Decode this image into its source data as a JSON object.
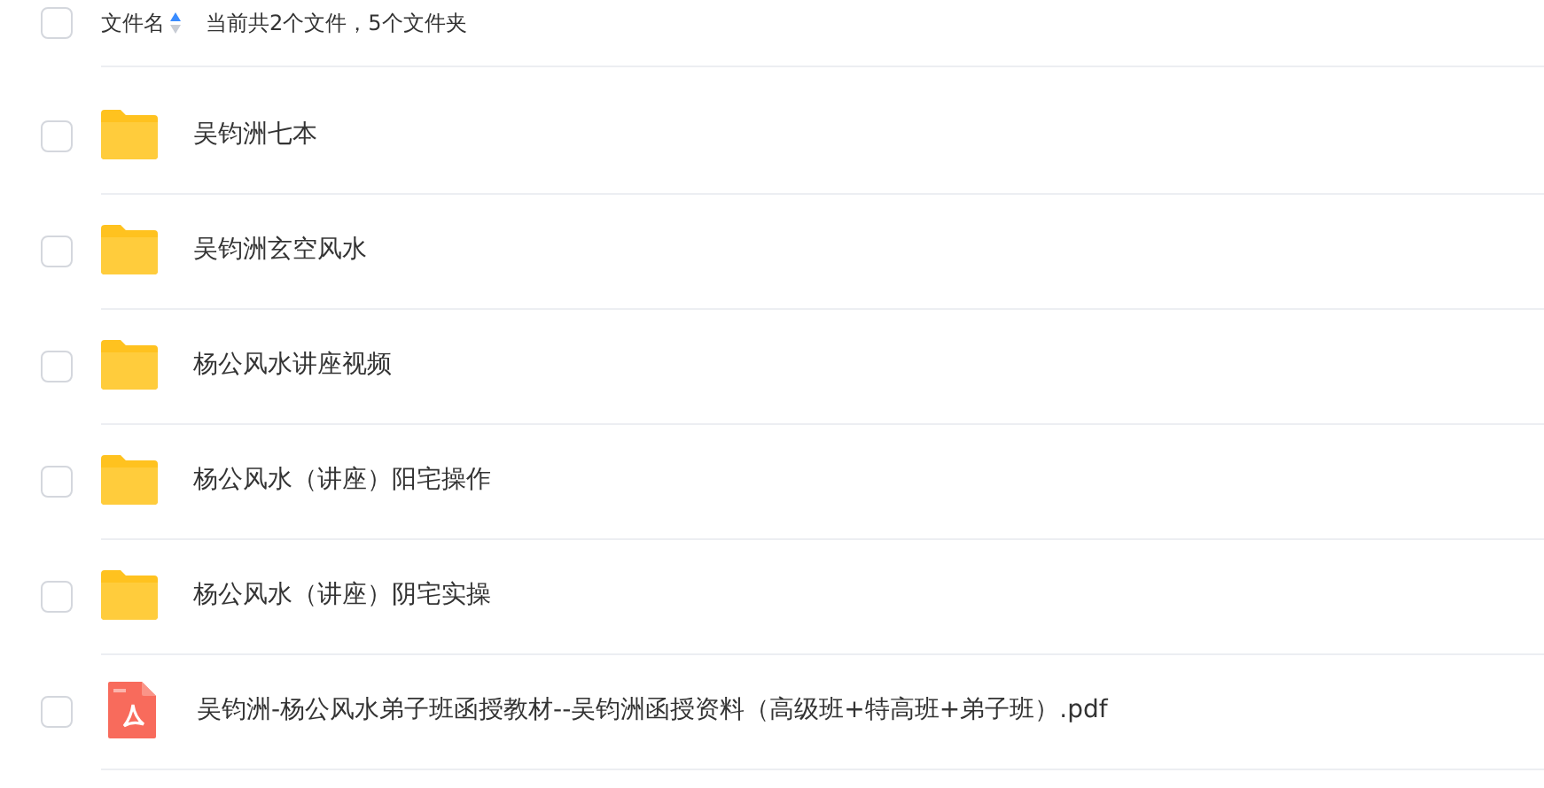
{
  "header": {
    "checked": false,
    "column_label": "文件名",
    "sort_ascending": true,
    "summary": "当前共2个文件，5个文件夹"
  },
  "files": [
    {
      "kind": "folder",
      "name": "吴钧洲七本",
      "checked": false
    },
    {
      "kind": "folder",
      "name": "吴钧洲玄空风水",
      "checked": false
    },
    {
      "kind": "folder",
      "name": "杨公风水讲座视频",
      "checked": false
    },
    {
      "kind": "folder",
      "name": "杨公风水（讲座）阳宅操作",
      "checked": false
    },
    {
      "kind": "folder",
      "name": "杨公风水（讲座）阴宅实操",
      "checked": false
    },
    {
      "kind": "pdf",
      "name": "吴钧洲-杨公风水弟子班函授教材--吴钧洲函授资料（高级班+特高班+弟子班）.pdf",
      "checked": false
    }
  ]
}
